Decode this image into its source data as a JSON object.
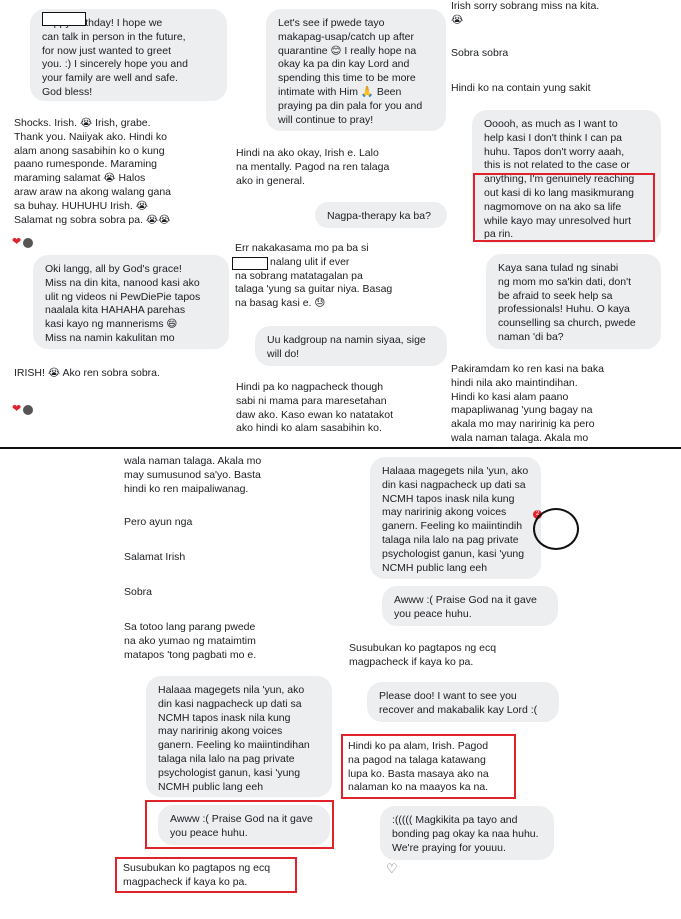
{
  "panel1": {
    "msg1": "happy birthday! I hope we\ncan talk in person in the future,\nfor now just wanted to greet\nyou. :) I sincerely hope you and\nyour family are well and safe.\nGod bless!",
    "msg2": "Shocks. Irish. 😭 Irish, grabe.\nThank you. Naiiyak ako. Hindi ko\nalam anong sasabihin ko o kung\npaano rumesponde. Maraming\nmaraming salamat 😭 Halos\naraw araw na akong walang gana\nsa buhay. HUHUHU Irish. 😭\nSalamat ng sobra sobra pa. 😭😭",
    "msg3": "Oki langg, all by God's grace!\nMiss na din kita, nanood kasi ako\nulit ng videos ni PewDiePie tapos\nnaalala kita HAHAHA parehas\nkasi kayo ng mannerisms 😄\nMiss na namin kakulitan mo",
    "msg4": "IRISH! 😭 Ako ren sobra sobra."
  },
  "panel2": {
    "msg1": "Let's see if pwede tayo\nmakapag-usap/catch up after\nquarantine 😊 I really hope na\nokay ka pa din kay Lord and\nspending this time to be more\nintimate with Him 🙏 Been\npraying pa din pala for you and\nwill continue to pray!",
    "msg2": "Hindi na ako okay, Irish e. Lalo\nna mentally. Pagod na ren talaga\nako in general.",
    "msg3": "Nagpa-therapy ka ba?",
    "msg4": "Err nakakasama mo pa ba si\n          Pasabi nalang ulit if ever\nna sobrang matatagalan pa\ntalaga 'yung sa guitar niya. Basag\nna basag kasi e. 😓",
    "msg5": "Uu kadgroup na namin siyaa, sige\nwill do!",
    "msg6": "Hindi pa ko nagpacheck though\nsabi ni mama para maresetahan\ndaw ako. Kaso ewan ko natatakot\nako hindi ko alam sasabihin ko."
  },
  "panel3": {
    "msg1": "Irish sorry sobrang miss na kita.\n😭",
    "msg2": "Sobra sobra",
    "msg3": "Hindi ko na contain yung sakit",
    "msg4": "Ooooh, as much as I want to\nhelp kasi I don't think I can pa\nhuhu. Tapos don't worry aaah,\nthis is not related to the case or\nanything, I'm genuinely reaching\nout kasi di ko lang masikmurang\nnagmomove on na ako sa life\nwhile kayo may unresolved hurt\npa rin.",
    "msg5": "Kaya sana tulad ng sinabi\nng mom mo sa'kin dati, don't\nbe afraid to seek help sa\nprofessionals! Huhu. O kaya\ncounselling sa church, pwede\nnaman 'di ba?",
    "msg6": "Pakiramdam ko ren kasi na baka\nhindi nila ako maintindihan.\nHindi ko kasi alam paano\nmapapliwanag 'yung bagay na\nakala mo may naririnig ka pero\nwala naman talaga. Akala mo"
  },
  "panel4": {
    "msg1": "wala naman talaga. Akala mo\nmay sumusunod sa'yo. Basta\nhindi ko ren maipaliwanag.",
    "msg2": "Pero ayun nga",
    "msg3": "Salamat Irish",
    "msg4": "Sobra",
    "msg5": "Sa totoo lang parang pwede\nna ako yumao ng mataimtim\nmatapos 'tong pagbati mo e.",
    "msg6": "Halaaa magegets nila 'yun, ako\ndin kasi nagpacheck up dati sa\nNCMH tapos inask nila kung\nmay naririnig akong voices\nganern. Feeling ko maiintindihan\ntalaga nila lalo na pag private\npsychologist ganun, kasi 'yung\nNCMH public lang eeh",
    "msg7": "Awww :( Praise God na it gave\nyou peace huhu.",
    "msg8": "Susubukan ko pagtapos ng ecq\nmagpacheck if kaya ko pa."
  },
  "panel5": {
    "msg1": "Halaaa magegets nila 'yun, ako\ndin kasi nagpacheck up dati sa\nNCMH tapos inask nila kung\nmay naririnig akong voices\nganern. Feeling ko maiintindih\ntalaga nila lalo na pag private\npsychologist ganun, kasi 'yung\nNCMH public lang eeh",
    "msg2": "Awww :( Praise God na it gave\nyou peace huhu.",
    "msg3": "Susubukan ko pagtapos ng ecq\nmagpacheck if kaya ko pa.",
    "msg4": "Please doo! I want to see you\nrecover and makabalik kay Lord :(",
    "msg5": "Hindi ko pa alam, Irish. Pagod\nna pagod na talaga katawang\nlupa ko. Basta masaya ako na\nnalaman ko na maayos ka na.",
    "msg6": ":((((( Magkikita pa tayo and\nbonding pag okay ka naa huhu.\nWe're praying for youuu.",
    "badge": "2"
  },
  "colors": {
    "bubble": "#eceef0",
    "annotation_red": "#e0232b",
    "heart": "#e0232b"
  }
}
